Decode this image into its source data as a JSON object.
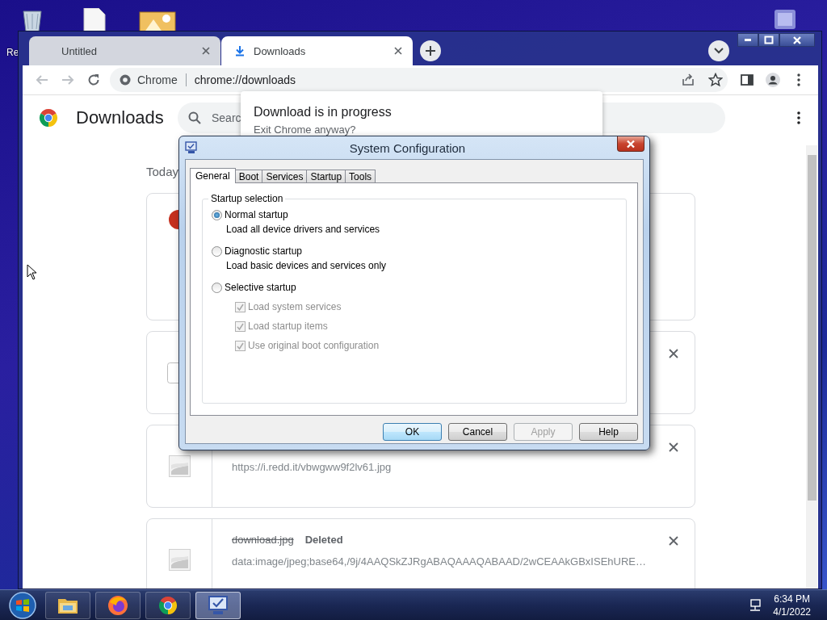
{
  "desktop": {
    "icon_label": "Re"
  },
  "browser": {
    "tabs": [
      {
        "title": "Untitled",
        "selected": false
      },
      {
        "title": "Downloads",
        "selected": true
      }
    ],
    "address": {
      "site": "Chrome",
      "url": "chrome://downloads"
    },
    "page": {
      "title": "Downloads",
      "search_placeholder": "Searc",
      "section": "Today",
      "downloads": [
        {
          "kind": "in_progress"
        },
        {
          "kind": "file"
        },
        {
          "kind": "image",
          "url": "https://i.redd.it/vbwgww9f2lv61.jpg"
        },
        {
          "kind": "deleted",
          "name": "download.jpg",
          "status": "Deleted",
          "url": "data:image/jpeg;base64,/9j/4AAQSkZJRgABAQAAAQABAAD/2wCEAAkGBxISEhURE…"
        }
      ]
    },
    "popup": {
      "title": "Download is in progress",
      "message": "Exit Chrome anyway?"
    }
  },
  "dialog": {
    "title": "System Configuration",
    "tabs": [
      {
        "label": "General",
        "selected": true
      },
      {
        "label": "Boot",
        "selected": false
      },
      {
        "label": "Services",
        "selected": false
      },
      {
        "label": "Startup",
        "selected": false
      },
      {
        "label": "Tools",
        "selected": false
      }
    ],
    "group": "Startup selection",
    "options": [
      {
        "label": "Normal startup",
        "description": "Load all device drivers and services",
        "selected": true
      },
      {
        "label": "Diagnostic startup",
        "description": "Load basic devices and services only",
        "selected": false
      },
      {
        "label": "Selective startup",
        "selected": false,
        "items": [
          {
            "label": "Load system services",
            "checked": true,
            "disabled": true
          },
          {
            "label": "Load startup items",
            "checked": true,
            "disabled": true
          },
          {
            "label": "Use original boot configuration",
            "checked": true,
            "disabled": true
          }
        ]
      }
    ],
    "buttons": [
      {
        "label": "OK",
        "default": true,
        "disabled": false
      },
      {
        "label": "Cancel",
        "default": false,
        "disabled": false
      },
      {
        "label": "Apply",
        "default": false,
        "disabled": true
      },
      {
        "label": "Help",
        "default": false,
        "disabled": false
      }
    ]
  },
  "taskbar": {
    "apps": [
      {
        "kind": "explorer",
        "active": false
      },
      {
        "kind": "firefox",
        "active": false
      },
      {
        "kind": "chrome",
        "active": false
      },
      {
        "kind": "msconfig",
        "active": true
      }
    ],
    "time": "6:34 PM",
    "date": "4/1/2022"
  }
}
